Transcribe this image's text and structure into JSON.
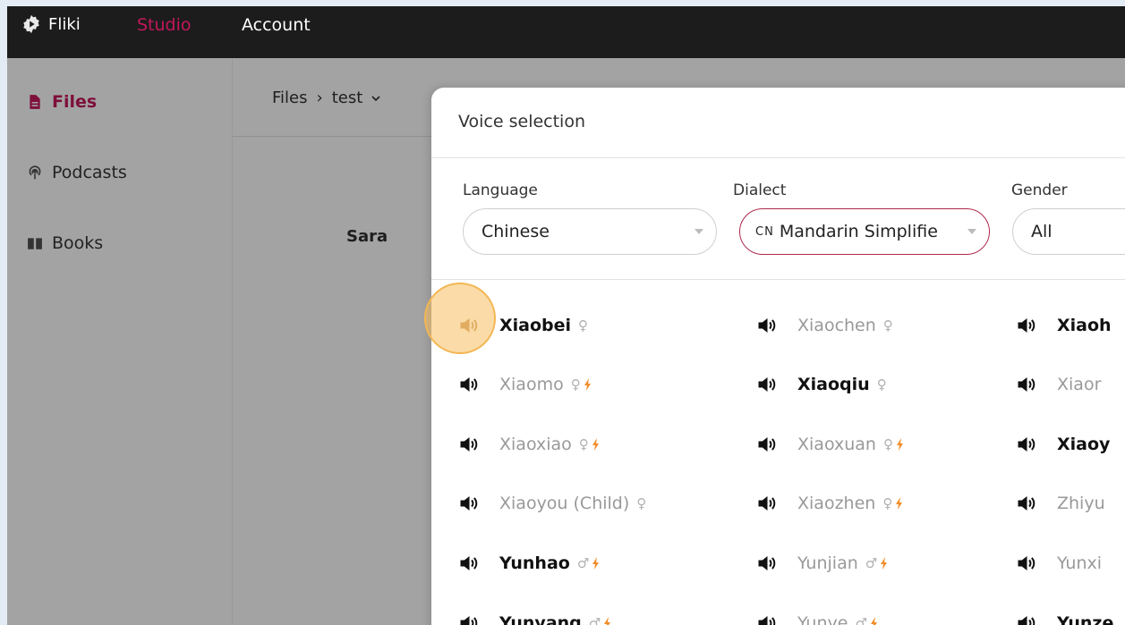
{
  "topbar": {
    "brand": "Fliki",
    "studio": "Studio",
    "account": "Account"
  },
  "sidebar": {
    "items": [
      {
        "label": "Files",
        "icon": "file-icon",
        "active": true
      },
      {
        "label": "Podcasts",
        "icon": "podcast-icon",
        "active": false
      },
      {
        "label": "Books",
        "icon": "book-icon",
        "active": false
      }
    ]
  },
  "breadcrumb": {
    "root": "Files",
    "sep": "›",
    "current": "test"
  },
  "main": {
    "speaker": "Sara"
  },
  "modal": {
    "title": "Voice selection",
    "filters": {
      "language_label": "Language",
      "language_value": "Chinese",
      "dialect_label": "Dialect",
      "dialect_flag": "CN",
      "dialect_value": "Mandarin Simplifie",
      "gender_label": "Gender",
      "gender_value": "All"
    },
    "voices": [
      [
        {
          "name": "Xiaobei",
          "gender": "♀",
          "premium": false,
          "active": true
        },
        {
          "name": "Xiaochen",
          "gender": "♀",
          "premium": false,
          "active": false
        },
        {
          "name": "Xiaoh",
          "gender": "",
          "premium": false,
          "active": true
        }
      ],
      [
        {
          "name": "Xiaomo",
          "gender": "♀",
          "premium": true,
          "active": false
        },
        {
          "name": "Xiaoqiu",
          "gender": "♀",
          "premium": false,
          "active": true
        },
        {
          "name": "Xiaor",
          "gender": "",
          "premium": false,
          "active": false
        }
      ],
      [
        {
          "name": "Xiaoxiao",
          "gender": "♀",
          "premium": true,
          "active": false
        },
        {
          "name": "Xiaoxuan",
          "gender": "♀",
          "premium": true,
          "active": false
        },
        {
          "name": "Xiaoy",
          "gender": "",
          "premium": false,
          "active": true
        }
      ],
      [
        {
          "name": "Xiaoyou (Child)",
          "gender": "♀",
          "premium": false,
          "active": false
        },
        {
          "name": "Xiaozhen",
          "gender": "♀",
          "premium": true,
          "active": false
        },
        {
          "name": "Zhiyu",
          "gender": "",
          "premium": false,
          "active": false
        }
      ],
      [
        {
          "name": "Yunhao",
          "gender": "♂",
          "premium": true,
          "active": true
        },
        {
          "name": "Yunjian",
          "gender": "♂",
          "premium": true,
          "active": false
        },
        {
          "name": "Yunxi",
          "gender": "",
          "premium": false,
          "active": false
        }
      ],
      [
        {
          "name": "Yunyang",
          "gender": "♂",
          "premium": true,
          "active": true
        },
        {
          "name": "Yunye",
          "gender": "♂",
          "premium": true,
          "active": false
        },
        {
          "name": "Yunze",
          "gender": "",
          "premium": false,
          "active": true
        }
      ]
    ]
  },
  "colors": {
    "accent": "#c2185b",
    "bolt": "#f28c28",
    "topbar": "#1c1c1c"
  }
}
